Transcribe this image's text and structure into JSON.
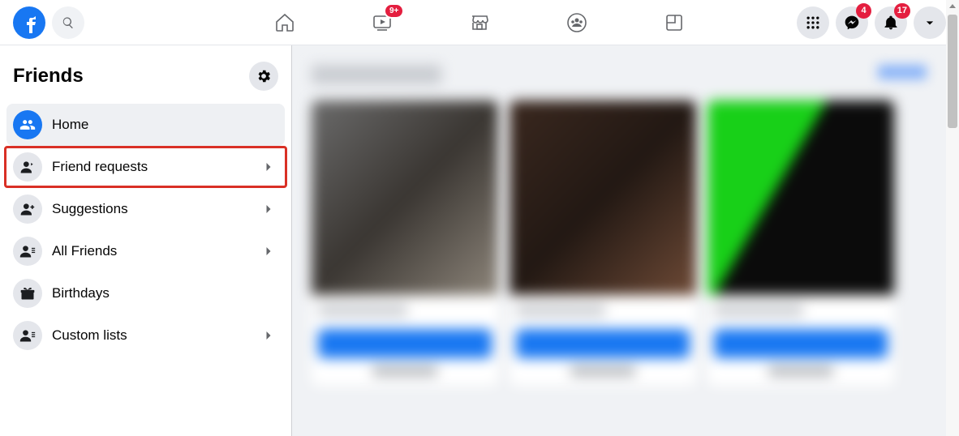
{
  "header": {
    "watch_badge": "9+",
    "messenger_badge": "4",
    "notifications_badge": "17"
  },
  "sidebar": {
    "title": "Friends",
    "items": [
      {
        "label": "Home",
        "icon": "friends",
        "active": true,
        "chevron": false,
        "highlighted": false
      },
      {
        "label": "Friend requests",
        "icon": "person-arrow",
        "active": false,
        "chevron": true,
        "highlighted": true
      },
      {
        "label": "Suggestions",
        "icon": "person-plus",
        "active": false,
        "chevron": true,
        "highlighted": false
      },
      {
        "label": "All Friends",
        "icon": "person-list",
        "active": false,
        "chevron": true,
        "highlighted": false
      },
      {
        "label": "Birthdays",
        "icon": "gift",
        "active": false,
        "chevron": false,
        "highlighted": false
      },
      {
        "label": "Custom lists",
        "icon": "person-list",
        "active": false,
        "chevron": true,
        "highlighted": false
      }
    ]
  },
  "colors": {
    "primary": "#1877f2",
    "badge": "#e41e3f",
    "highlight_border": "#d93025"
  }
}
